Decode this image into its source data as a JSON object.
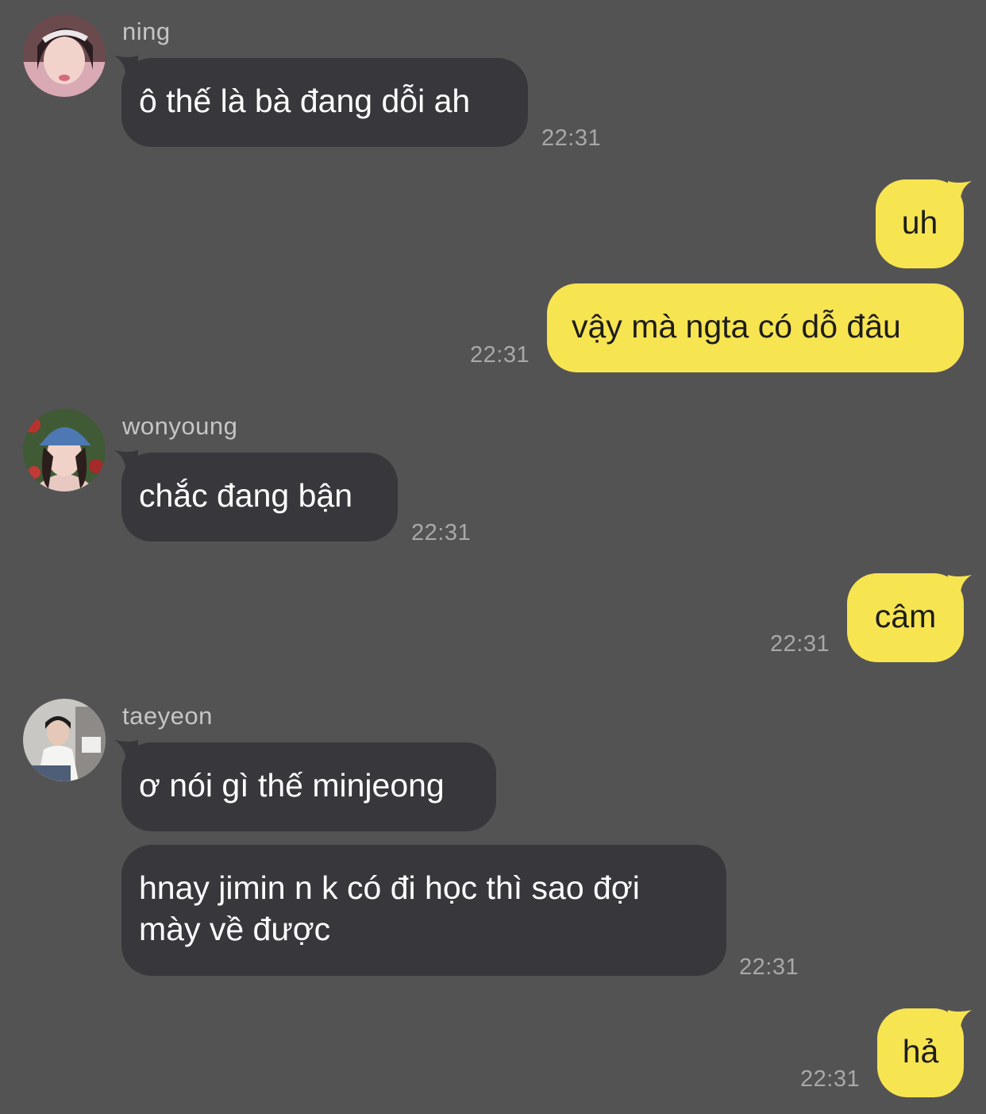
{
  "colors": {
    "background": "#545354",
    "incoming_bubble": "#38373b",
    "outgoing_bubble": "#f7e451",
    "timestamp": "#a9a8a9",
    "sender_name": "#c6c5c6"
  },
  "messages": [
    {
      "sender": "ning",
      "direction": "incoming",
      "avatar": "avatar-ning",
      "text": "ô thế là bà đang dỗi ah",
      "time": "22:31"
    },
    {
      "direction": "outgoing",
      "text": "uh"
    },
    {
      "direction": "outgoing",
      "text": "vậy mà ngta có dỗ đâu",
      "time": "22:31"
    },
    {
      "sender": "wonyoung",
      "direction": "incoming",
      "avatar": "avatar-wonyoung",
      "text": "chắc đang bận",
      "time": "22:31"
    },
    {
      "direction": "outgoing",
      "text": "câm",
      "time": "22:31"
    },
    {
      "sender": "taeyeon",
      "direction": "incoming",
      "avatar": "avatar-taeyeon",
      "text": "ơ nói gì thế minjeong"
    },
    {
      "direction": "incoming",
      "text": "hnay jimin n k có đi học thì sao đợi mày về được",
      "time": "22:31"
    },
    {
      "direction": "outgoing",
      "text": "hả",
      "time": "22:31"
    }
  ]
}
